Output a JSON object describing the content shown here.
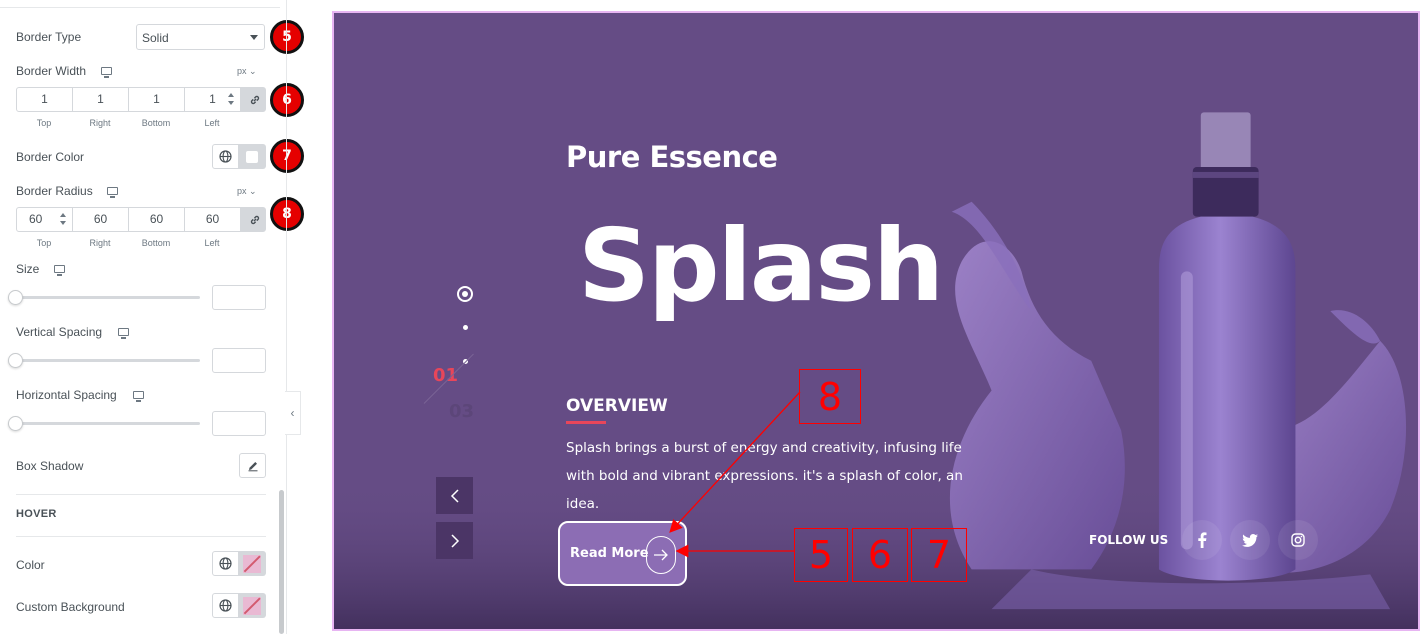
{
  "panel": {
    "border_type": {
      "label": "Border Type",
      "value": "Solid",
      "badge": "5"
    },
    "border_width": {
      "label": "Border Width",
      "unit": "px ⌄",
      "badge": "6",
      "values": [
        "1",
        "1",
        "1",
        "1"
      ],
      "captions": [
        "Top",
        "Right",
        "Bottom",
        "Left"
      ]
    },
    "border_color": {
      "label": "Border Color",
      "badge": "7"
    },
    "border_radius": {
      "label": "Border Radius",
      "unit": "px ⌄",
      "badge": "8",
      "values": [
        "60",
        "60",
        "60",
        "60"
      ],
      "captions": [
        "Top",
        "Right",
        "Bottom",
        "Left"
      ]
    },
    "size": {
      "label": "Size"
    },
    "vertical_spacing": {
      "label": "Vertical Spacing"
    },
    "horizontal_spacing": {
      "label": "Horizontal Spacing"
    },
    "box_shadow": {
      "label": "Box Shadow"
    },
    "hover": {
      "heading": "HOVER",
      "color_label": "Color",
      "background_label": "Custom Background"
    },
    "collapse_glyph": "‹"
  },
  "slide": {
    "subtitle": "Pure Essence",
    "title": "Splash",
    "current": "01",
    "total": "03",
    "overview_heading": "OVERVIEW",
    "description": "Splash brings a burst of energy and creativity, infusing life with bold and vibrant expressions. it's a splash of color, an idea.",
    "button_label": "Read More",
    "follow_label": "FOLLOW US",
    "social_icons": [
      "facebook-icon",
      "twitter-icon",
      "instagram-icon"
    ]
  },
  "annotations": {
    "box_8": "8",
    "box_5": "5",
    "box_6": "6",
    "box_7": "7"
  },
  "colors": {
    "slide_background": "#654c85",
    "accent_red": "#e8465a",
    "badge_red": "#e50000",
    "annotation_red": "#ff0000",
    "button_fill": "#8c6db4",
    "preview_border": "#e7b5f2"
  }
}
